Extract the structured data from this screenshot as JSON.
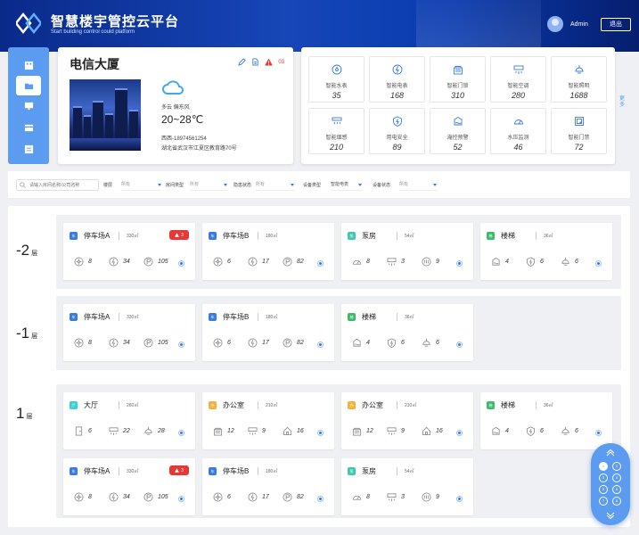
{
  "header": {
    "title": "智慧楼宇管控云平台",
    "subtitle": "Start building control could platform",
    "user": "Admin",
    "logout": "退出"
  },
  "building": {
    "name": "电信大厦",
    "alarm_count": "03",
    "weather": "多云 偏东风",
    "temp": "20~28℃",
    "contact": "西西-18974561254",
    "address": "湖北省武汉市江夏区教育路70号"
  },
  "devices": [
    {
      "label": "智能水表",
      "value": "35",
      "icon": "water-meter-icon"
    },
    {
      "label": "智能电表",
      "value": "168",
      "icon": "electric-meter-icon"
    },
    {
      "label": "智能门锁",
      "value": "310",
      "icon": "door-lock-icon"
    },
    {
      "label": "智能空调",
      "value": "280",
      "icon": "air-conditioner-icon"
    },
    {
      "label": "智能照明",
      "value": "1688",
      "icon": "lighting-icon"
    },
    {
      "label": "智能烟感",
      "value": "210",
      "icon": "smoke-sensor-icon"
    },
    {
      "label": "用电安全",
      "value": "89",
      "icon": "power-safety-icon"
    },
    {
      "label": "淹控预警",
      "value": "52",
      "icon": "flood-warning-icon"
    },
    {
      "label": "水压监测",
      "value": "46",
      "icon": "water-pressure-icon"
    },
    {
      "label": "智能门禁",
      "value": "72",
      "icon": "access-control-icon"
    }
  ],
  "more": "更多",
  "filters": {
    "search_placeholder": "请输入房间名称/公司名称",
    "items": [
      {
        "label": "楼层",
        "value": "所有"
      },
      {
        "label": "房间类型",
        "value": "所有"
      },
      {
        "label": "隐患状态",
        "value": "所有"
      },
      {
        "label": "设备类型",
        "value": "智能电表"
      },
      {
        "label": "设备状态",
        "value": "所有"
      }
    ]
  },
  "floor_unit": "层",
  "floors": [
    {
      "label": "-2",
      "rooms": [
        {
          "tag": "车",
          "tag_color": "#3a7be0",
          "name": "停车场A",
          "area": "330㎡",
          "alarm": "3",
          "stats": [
            {
              "icon": "fan-icon",
              "v": "8"
            },
            {
              "icon": "meter-icon",
              "v": "34"
            },
            {
              "icon": "parking-icon",
              "v": "105"
            }
          ]
        },
        {
          "tag": "车",
          "tag_color": "#3a7be0",
          "name": "停车场B",
          "area": "180㎡",
          "stats": [
            {
              "icon": "fan-icon",
              "v": "6"
            },
            {
              "icon": "meter-icon",
              "v": "17"
            },
            {
              "icon": "parking-icon",
              "v": "82"
            }
          ]
        },
        {
          "tag": "泵",
          "tag_color": "#3fc8b0",
          "name": "泵房",
          "area": "54㎡",
          "stats": [
            {
              "icon": "gauge-icon",
              "v": "8"
            },
            {
              "icon": "ac-icon",
              "v": "3"
            },
            {
              "icon": "water-icon",
              "v": "9"
            }
          ]
        },
        {
          "tag": "梯",
          "tag_color": "#3fba6a",
          "name": "楼梯",
          "area": "36㎡",
          "stats": [
            {
              "icon": "flood-icon",
              "v": "4"
            },
            {
              "icon": "safety-icon",
              "v": "6"
            },
            {
              "icon": "lamp-icon",
              "v": "6"
            }
          ]
        }
      ]
    },
    {
      "label": "-1",
      "rooms": [
        {
          "tag": "车",
          "tag_color": "#3a7be0",
          "name": "停车场A",
          "area": "330㎡",
          "stats": [
            {
              "icon": "fan-icon",
              "v": "8"
            },
            {
              "icon": "meter-icon",
              "v": "34"
            },
            {
              "icon": "parking-icon",
              "v": "105"
            }
          ]
        },
        {
          "tag": "车",
          "tag_color": "#3a7be0",
          "name": "停车场B",
          "area": "180㎡",
          "stats": [
            {
              "icon": "fan-icon",
              "v": "6"
            },
            {
              "icon": "meter-icon",
              "v": "17"
            },
            {
              "icon": "parking-icon",
              "v": "82"
            }
          ]
        },
        {
          "tag": "梯",
          "tag_color": "#3fba6a",
          "name": "楼梯",
          "area": "36㎡",
          "stats": [
            {
              "icon": "flood-icon",
              "v": "4"
            },
            {
              "icon": "safety-icon",
              "v": "6"
            },
            {
              "icon": "lamp-icon",
              "v": "6"
            }
          ]
        }
      ]
    },
    {
      "label": "1",
      "rooms": [
        {
          "tag": "厅",
          "tag_color": "#3ccfd0",
          "name": "大厅",
          "area": "260㎡",
          "stats": [
            {
              "icon": "door-icon",
              "v": "6"
            },
            {
              "icon": "ac-icon",
              "v": "22"
            },
            {
              "icon": "lamp-icon",
              "v": "28"
            }
          ]
        },
        {
          "tag": "办",
          "tag_color": "#f3b23c",
          "name": "办公室",
          "area": "210㎡",
          "stats": [
            {
              "icon": "lock-icon",
              "v": "12"
            },
            {
              "icon": "ac-icon",
              "v": "9"
            },
            {
              "icon": "home-icon",
              "v": "16"
            }
          ]
        },
        {
          "tag": "办",
          "tag_color": "#f3b23c",
          "name": "办公室",
          "area": "210㎡",
          "stats": [
            {
              "icon": "lock-icon",
              "v": "12"
            },
            {
              "icon": "ac-icon",
              "v": "9"
            },
            {
              "icon": "home-icon",
              "v": "16"
            }
          ]
        },
        {
          "tag": "梯",
          "tag_color": "#3fba6a",
          "name": "楼梯",
          "area": "36㎡",
          "stats": [
            {
              "icon": "flood-icon",
              "v": "4"
            },
            {
              "icon": "safety-icon",
              "v": "6"
            },
            {
              "icon": "lamp-icon",
              "v": "6"
            }
          ]
        },
        {
          "tag": "车",
          "tag_color": "#3a7be0",
          "name": "停车场A",
          "area": "330㎡",
          "alarm": "3",
          "stats": [
            {
              "icon": "fan-icon",
              "v": "8"
            },
            {
              "icon": "meter-icon",
              "v": "34"
            },
            {
              "icon": "parking-icon",
              "v": "105"
            }
          ]
        },
        {
          "tag": "车",
          "tag_color": "#3a7be0",
          "name": "停车场B",
          "area": "180㎡",
          "stats": [
            {
              "icon": "fan-icon",
              "v": "6"
            },
            {
              "icon": "meter-icon",
              "v": "17"
            },
            {
              "icon": "parking-icon",
              "v": "82"
            }
          ]
        },
        {
          "tag": "泵",
          "tag_color": "#3fc8b0",
          "name": "泵房",
          "area": "54㎡",
          "stats": [
            {
              "icon": "gauge-icon",
              "v": "8"
            },
            {
              "icon": "ac-icon",
              "v": "3"
            },
            {
              "icon": "water-icon",
              "v": "9"
            }
          ]
        }
      ]
    }
  ],
  "floor_nav": {
    "items": [
      "1",
      "2",
      "3",
      "4",
      "5",
      "6",
      "7",
      "8"
    ],
    "active": "1"
  }
}
